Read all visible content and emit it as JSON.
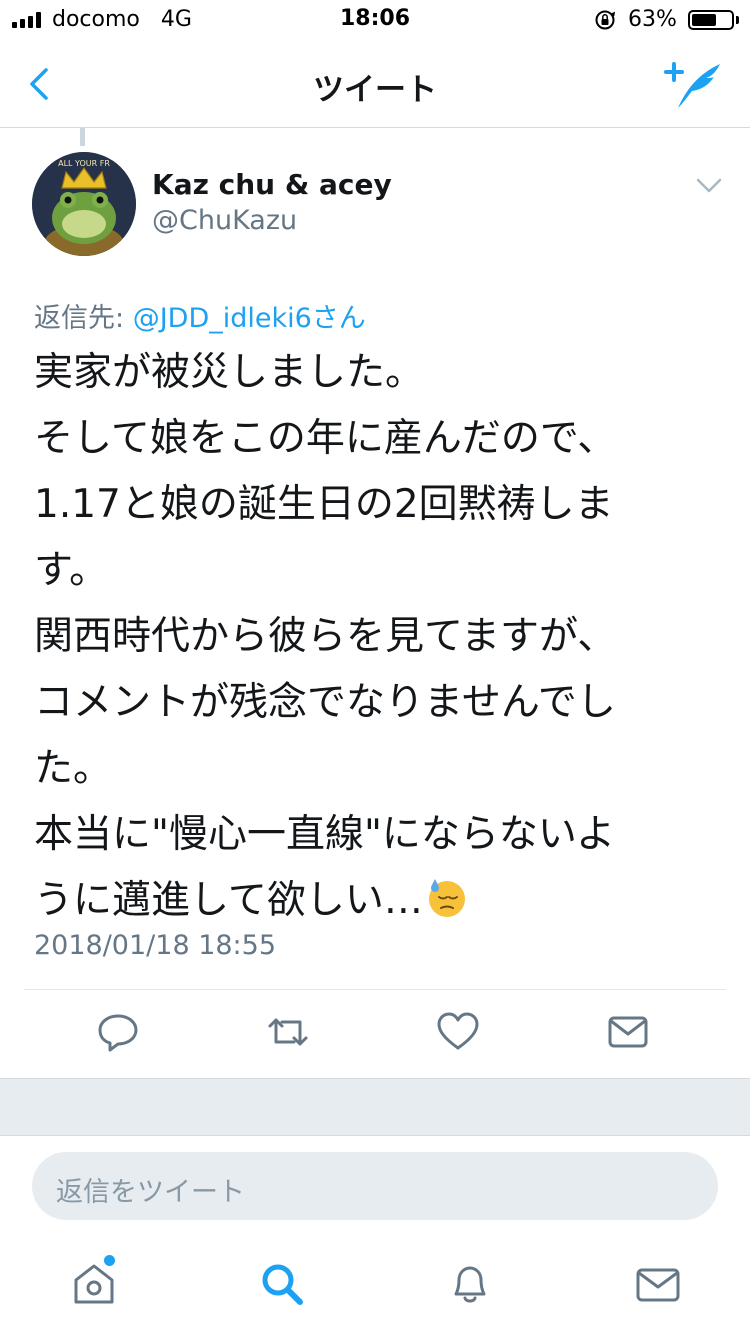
{
  "status_bar": {
    "carrier": "docomo",
    "network": "4G",
    "time": "18:06",
    "battery_percent": "63%",
    "battery_level": 0.63,
    "icons": [
      "signal-icon",
      "orientation-lock-icon",
      "battery-icon"
    ]
  },
  "nav": {
    "title": "ツイート",
    "back_icon": "chevron-left-icon",
    "compose_icon": "compose-tweet-icon"
  },
  "tweet": {
    "display_name": "Kaz chu & acey",
    "handle": "@ChuKazu",
    "reply_prefix": "返信先: ",
    "reply_mention": "@JDD_idleki6さん",
    "lines": [
      "実家が被災しました。",
      "そして娘をこの年に産んだので、",
      "1.17と娘の誕生日の2回黙祷しま",
      "す。",
      "関西時代から彼らを見てますが、",
      "コメントが残念でなりませんでし",
      "た。",
      "本当に\"慢心一直線\"にならないよ",
      "うに邁進して欲しい…"
    ],
    "emoji": "downcast-sweat-face",
    "timestamp": "2018/01/18 18:55"
  },
  "actions": [
    "reply-icon",
    "retweet-icon",
    "like-icon",
    "direct-message-icon"
  ],
  "reply_box": {
    "placeholder": "返信をツイート"
  },
  "tabs": [
    "home-icon",
    "search-icon",
    "notifications-icon",
    "messages-icon"
  ],
  "colors": {
    "accent": "#1da1f2",
    "text": "#14171a",
    "secondary": "#657786",
    "icon_gray": "#657786",
    "band": "#e6ecf0"
  }
}
